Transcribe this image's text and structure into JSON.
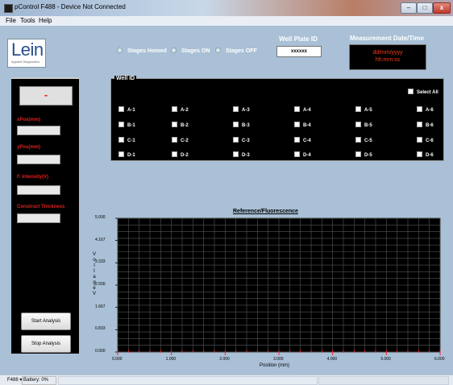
{
  "window": {
    "title": "pControl F488 - Device Not Connected",
    "controls": [
      "–",
      "□",
      "x"
    ]
  },
  "menu": [
    "File",
    "Tools",
    "Help"
  ],
  "logo": {
    "wordmark": "Lein",
    "subtitle": "Applied Diagnostics"
  },
  "stage_controls": [
    "Stages Homed",
    "Stages ON",
    "Stages OFF"
  ],
  "well_plate": {
    "label": "Well Plate ID",
    "value": "xxxxxx"
  },
  "measurement": {
    "label": "Measurement Date/Time",
    "date": "dd/mm/yyyy",
    "time": "hh:mm:ss"
  },
  "left_panel": {
    "display_value": "-",
    "fields": [
      {
        "label": "xPos(mm)",
        "value": ""
      },
      {
        "label": "yPos(mm)",
        "value": ""
      },
      {
        "label": "F. Intensity(V)",
        "value": ""
      },
      {
        "label": "Construct Thickness",
        "value": ""
      }
    ],
    "buttons": [
      "Start Analysis",
      "Stop Analysis"
    ]
  },
  "wells": {
    "label": "Well ID",
    "select_all": "Select All",
    "rows": [
      [
        "A-1",
        "A-2",
        "A-3",
        "A-4",
        "A-5",
        "A-6"
      ],
      [
        "B-1",
        "B-2",
        "B-3",
        "B-4",
        "B-5",
        "B-6"
      ],
      [
        "C-1",
        "C-2",
        "C-3",
        "C-4",
        "C-5",
        "C-6"
      ],
      [
        "D-1",
        "D-2",
        "D-3",
        "D-4",
        "D-5",
        "D-6"
      ]
    ]
  },
  "status": {
    "selector": "F488",
    "battery": "Battery: 0%"
  },
  "colors": {
    "panel_bg": "#000000",
    "field_label": "#e02020",
    "datetime_text": "#ff3a1a",
    "plot_bg": "#000000",
    "grid": "#555555",
    "tick_mark": "#ff2020"
  },
  "chart_data": {
    "type": "line",
    "title": "Reference/Fluorescence",
    "xlabel": "Position (mm)",
    "ylabel": "Voltage V",
    "xlim": [
      0,
      6
    ],
    "ylim": [
      0,
      5
    ],
    "x_ticks": [
      "0.000",
      "1.000",
      "2.000",
      "3.000",
      "4.000",
      "5.000",
      "6.000"
    ],
    "y_ticks": [
      "5.000",
      "4.167",
      "3.333",
      "2.500",
      "1.667",
      "0.833",
      "0.000"
    ],
    "grid": true,
    "series": []
  }
}
